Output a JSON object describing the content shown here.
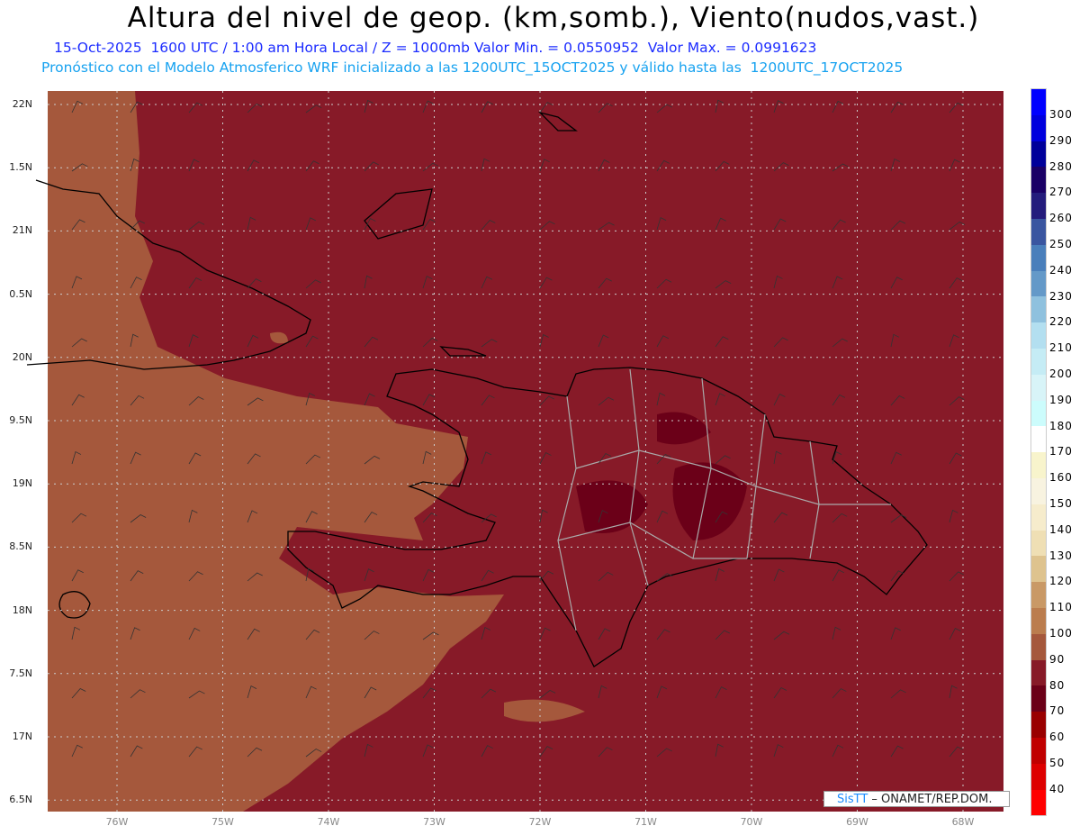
{
  "title": "Altura del nivel de geop. (km,somb.), Viento(nudos,vast.)",
  "subtitle": "15-Oct-2025  1600 UTC / 1:00 am Hora Local / Z = 1000mb Valor Min. = 0.0550952  Valor Max. = 0.0991623",
  "info": "Pronóstico con el Modelo Atmosferico WRF inicializado a las 1200UTC_15OCT2025 y válido hasta las  1200UTC_17OCT2025",
  "lat_labels": [
    "22N",
    "1.5N",
    "21N",
    "0.5N",
    "20N",
    "9.5N",
    "19N",
    "8.5N",
    "18N",
    "7.5N",
    "17N",
    "6.5N"
  ],
  "lon_labels": [
    "76W",
    "75W",
    "74W",
    "73W",
    "72W",
    "71W",
    "70W",
    "69W",
    "68W"
  ],
  "colorbar": {
    "colors": [
      "#0000ff",
      "#0000dd",
      "#00009a",
      "#1a0066",
      "#241c7c",
      "#3a56a0",
      "#4a7fbb",
      "#6499c8",
      "#8fc1de",
      "#b3dff0",
      "#c5ecf5",
      "#d8f4f8",
      "#ccfcfc",
      "#ffffff",
      "#f8f4cc",
      "#f8f3e0",
      "#f6eccc",
      "#efdfb4",
      "#dec38e",
      "#c99966",
      "#bb7d4e",
      "#a5583c",
      "#871a28",
      "#6b0018",
      "#990000",
      "#c00000",
      "#dd0000",
      "#ff0000"
    ],
    "labels": [
      "300",
      "290",
      "280",
      "270",
      "260",
      "250",
      "240",
      "230",
      "220",
      "210",
      "200",
      "190",
      "180",
      "170",
      "160",
      "150",
      "140",
      "130",
      "120",
      "110",
      "100",
      "90",
      "80",
      "70",
      "60",
      "50",
      "40"
    ]
  },
  "watermark": {
    "brand": "SisTT",
    "text": " – ONAMET/REP.DOM."
  }
}
